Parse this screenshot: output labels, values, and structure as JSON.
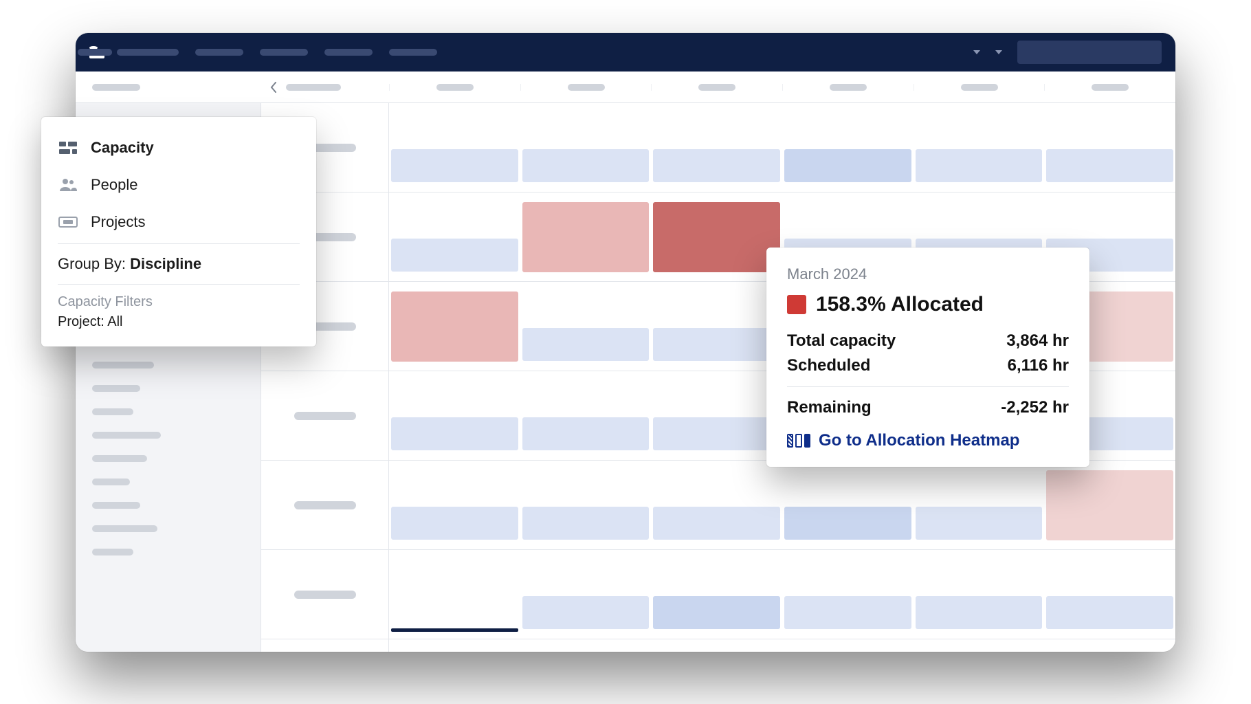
{
  "panel": {
    "items": [
      {
        "label": "Capacity"
      },
      {
        "label": "People"
      },
      {
        "label": "Projects"
      }
    ],
    "group_by_label": "Group By:",
    "group_by_value": "Discipline",
    "filters_heading": "Capacity Filters",
    "filters_line": "Project: All"
  },
  "tooltip": {
    "month": "March 2024",
    "allocated": "158.3% Allocated",
    "total_capacity_label": "Total capacity",
    "total_capacity_value": "3,864 hr",
    "scheduled_label": "Scheduled",
    "scheduled_value": "6,116 hr",
    "remaining_label": "Remaining",
    "remaining_value": "-2,252 hr",
    "link_label": "Go to Allocation Heatmap"
  },
  "sidebar_item_widths": [
    70,
    90,
    70,
    60,
    100,
    80,
    55,
    70,
    95,
    60
  ],
  "grid": {
    "rows": [
      {
        "bars": [
          [
            "half:bot:blue1"
          ],
          [
            "half:bot:blue1"
          ],
          [
            "half:bot:blue1"
          ],
          [
            "half:bot:blue2"
          ],
          [
            "half:bot:blue1"
          ],
          [
            "half:bot:blue1"
          ]
        ]
      },
      {
        "bars": [
          [
            "half:bot:blue1"
          ],
          [
            "full:red1"
          ],
          [
            "full:red3"
          ],
          [
            "half:bot:blue1"
          ],
          [
            "half:bot:blue1"
          ],
          [
            "half:bot:blue1"
          ]
        ]
      },
      {
        "bars": [
          [
            "full:red1"
          ],
          [
            "half:bot:blue1"
          ],
          [
            "half:bot:blue1"
          ],
          [
            "half:bot:blue1"
          ],
          [
            "half:bot:blue2"
          ],
          [
            "full:red0"
          ]
        ]
      },
      {
        "bars": [
          [
            "half:bot:blue1"
          ],
          [
            "half:bot:blue1"
          ],
          [
            "half:bot:blue1"
          ],
          [
            "half:bot:blue1"
          ],
          [
            "half:bot:blue1"
          ],
          [
            "half:bot:blue1"
          ]
        ]
      },
      {
        "bars": [
          [
            "half:bot:blue1"
          ],
          [
            "half:bot:blue1"
          ],
          [
            "half:bot:blue1"
          ],
          [
            "half:bot:blue2"
          ],
          [
            "half:bot:blue1"
          ],
          [
            "full:red0"
          ]
        ]
      },
      {
        "bars": [
          [
            "underline"
          ],
          [
            "half:bot:blue1"
          ],
          [
            "half:bot:blue2"
          ],
          [
            "half:bot:blue1"
          ],
          [
            "half:bot:blue1"
          ],
          [
            "half:bot:blue1"
          ]
        ]
      }
    ]
  }
}
